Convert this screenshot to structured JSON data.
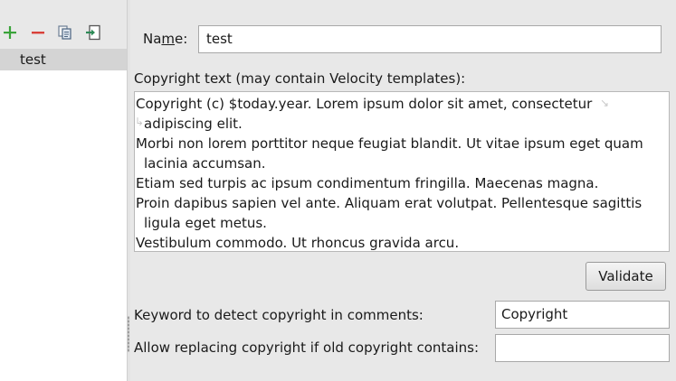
{
  "toolbar": {
    "icons": [
      "plus-icon",
      "minus-icon",
      "copy-icon",
      "import-icon"
    ],
    "colors": {
      "add": "#3aa33a",
      "remove": "#d9413a",
      "import": "#2e8b57"
    }
  },
  "profiles": {
    "items": [
      {
        "label": "test",
        "selected": true
      }
    ]
  },
  "form": {
    "name_label_pre": "Na",
    "name_label_mn": "m",
    "name_label_post": "e:",
    "name_value": "test",
    "copyright_label": "Copyright text (may contain Velocity templates):",
    "copyright_lines": [
      {
        "text": "Copyright (c) $today.year. Lorem ipsum dolor sit amet, consectetur",
        "cont": false
      },
      {
        "text": "adipiscing elit.",
        "cont": true
      },
      {
        "text": "Morbi non lorem porttitor neque feugiat blandit. Ut vitae ipsum eget quam",
        "cont": false
      },
      {
        "text": "lacinia accumsan.",
        "cont": true
      },
      {
        "text": "Etiam sed turpis ac ipsum condimentum fringilla. Maecenas magna.",
        "cont": false
      },
      {
        "text": "Proin dapibus sapien vel ante. Aliquam erat volutpat. Pellentesque sagittis",
        "cont": false
      },
      {
        "text": "ligula eget metus.",
        "cont": true
      },
      {
        "text": "Vestibulum commodo. Ut rhoncus gravida arcu.",
        "cont": false
      }
    ],
    "validate_label": "Validate",
    "keyword_label": "Keyword to detect copyright in comments:",
    "keyword_value": "Copyright",
    "allow_label": "Allow replacing copyright if old copyright contains:",
    "allow_value": ""
  }
}
